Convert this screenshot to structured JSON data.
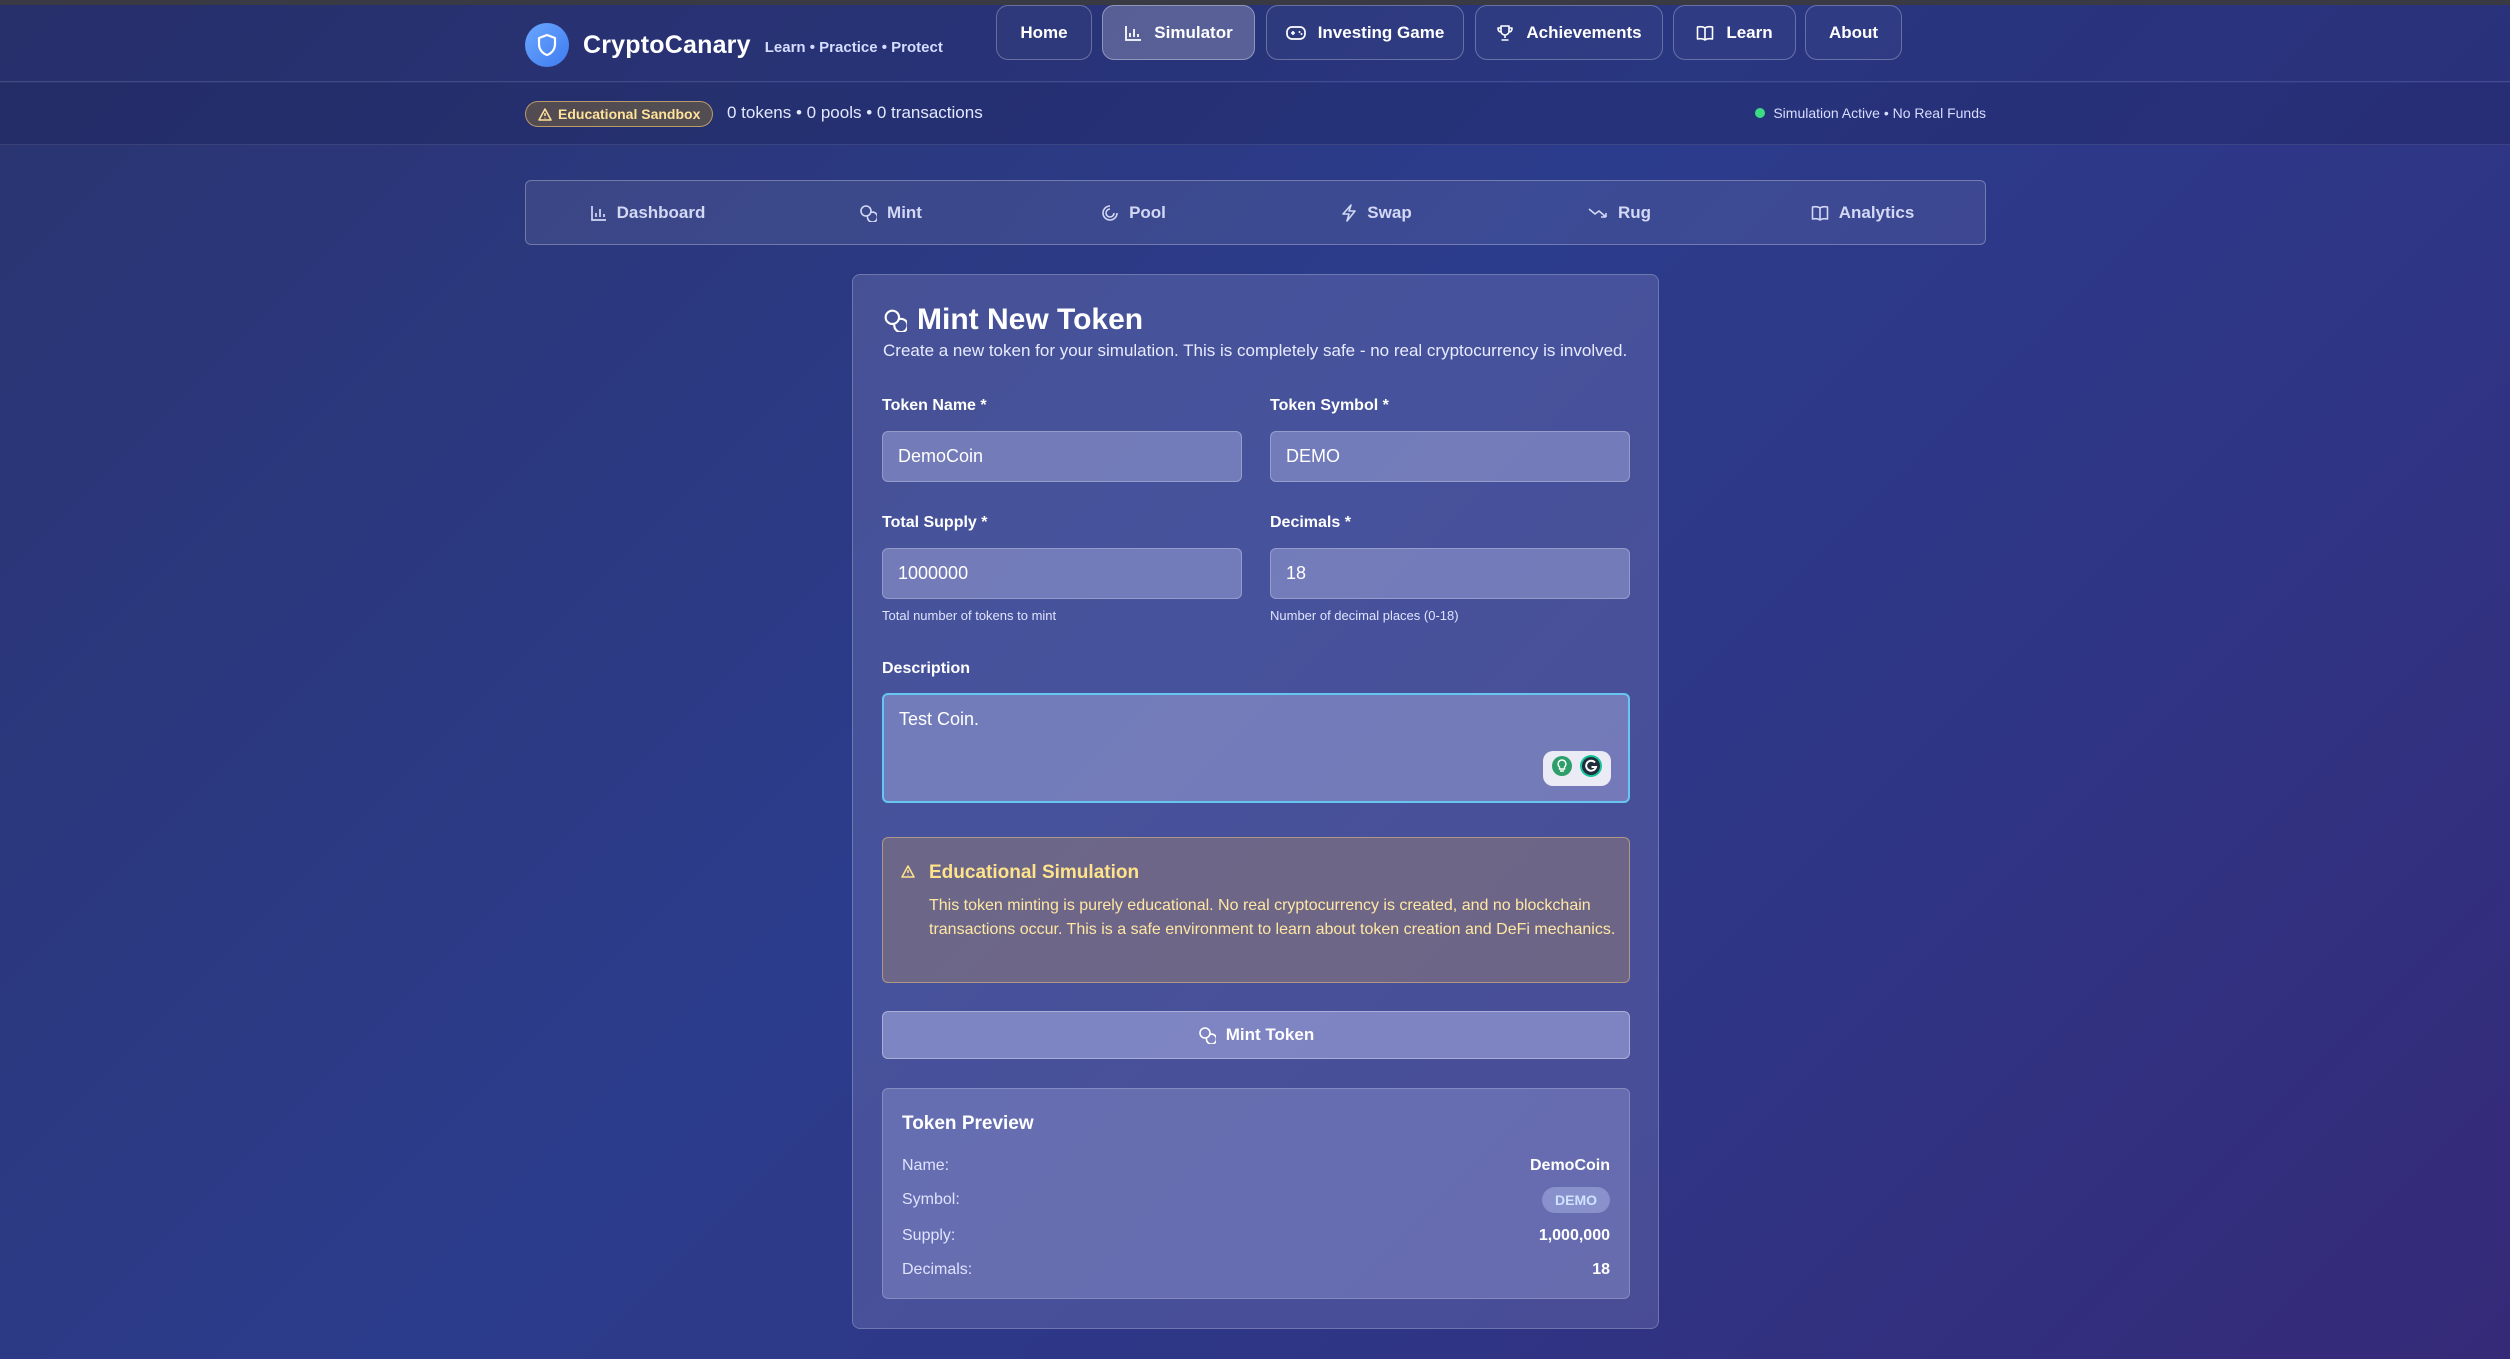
{
  "brand": {
    "name": "CryptoCanary",
    "tagline": "Learn • Practice • Protect"
  },
  "nav": [
    {
      "label": "Home",
      "icon": ""
    },
    {
      "label": "Simulator",
      "icon": "bar-chart-icon",
      "active": true
    },
    {
      "label": "Investing Game",
      "icon": "gamepad-icon"
    },
    {
      "label": "Achievements",
      "icon": "trophy-icon"
    },
    {
      "label": "Learn",
      "icon": "book-icon"
    },
    {
      "label": "About",
      "icon": ""
    }
  ],
  "subbar": {
    "badge": "Educational Sandbox",
    "stats": "0 tokens • 0 pools • 0 transactions",
    "status": "Simulation Active • No Real Funds",
    "status_color": "#3ddc84"
  },
  "tabs": [
    {
      "label": "Dashboard",
      "icon": "bar-chart-icon"
    },
    {
      "label": "Mint",
      "icon": "coins-icon"
    },
    {
      "label": "Pool",
      "icon": "pool-icon"
    },
    {
      "label": "Swap",
      "icon": "lightning-icon"
    },
    {
      "label": "Rug",
      "icon": "trend-down-icon"
    },
    {
      "label": "Analytics",
      "icon": "book-icon"
    }
  ],
  "form": {
    "title": "Mint New Token",
    "subtitle": "Create a new token for your simulation. This is completely safe - no real cryptocurrency is involved.",
    "token_name_label": "Token Name *",
    "token_name_value": "DemoCoin",
    "token_symbol_label": "Token Symbol *",
    "token_symbol_value": "DEMO",
    "total_supply_label": "Total Supply *",
    "total_supply_value": "1000000",
    "total_supply_hint": "Total number of tokens to mint",
    "decimals_label": "Decimals *",
    "decimals_value": "18",
    "decimals_hint": "Number of decimal places (0-18)",
    "description_label": "Description",
    "description_value": "Test Coin."
  },
  "warning": {
    "title": "Educational Simulation",
    "text": "This token minting is purely educational. No real cryptocurrency is created, and no blockchain transactions occur. This is a safe environment to learn about token creation and DeFi mechanics.",
    "color": "#ffe38a"
  },
  "mint_button": {
    "label": "Mint Token"
  },
  "preview": {
    "title": "Token Preview",
    "name_key": "Name:",
    "name_value": "DemoCoin",
    "symbol_key": "Symbol:",
    "symbol_value": "DEMO",
    "supply_key": "Supply:",
    "supply_value": "1,000,000",
    "decimals_key": "Decimals:",
    "decimals_value": "18"
  }
}
